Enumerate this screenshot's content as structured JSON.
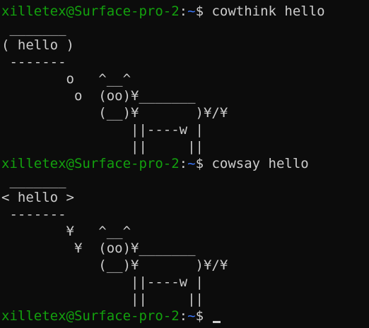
{
  "prompt": {
    "user_host": "xilletex@Surface-pro-2",
    "colon": ":",
    "path": "~",
    "dollar": "$ "
  },
  "colors": {
    "background": "#0c0c0c",
    "text": "#cccccc",
    "user_host": "#13a10e",
    "path": "#3b78ff"
  },
  "blocks": [
    {
      "command": "cowthink hello",
      "output": [
        " _______",
        "( hello )",
        " -------",
        "        o   ^__^",
        "         o  (oo)¥_______",
        "            (__)¥       )¥/¥",
        "                ||----w |",
        "                ||     ||"
      ]
    },
    {
      "command": "cowsay hello",
      "output": [
        " _______",
        "< hello >",
        " -------",
        "        ¥   ^__^",
        "         ¥  (oo)¥_______",
        "            (__)¥       )¥/¥",
        "                ||----w |",
        "                ||     ||"
      ]
    }
  ],
  "final_prompt_cursor": "cursor"
}
